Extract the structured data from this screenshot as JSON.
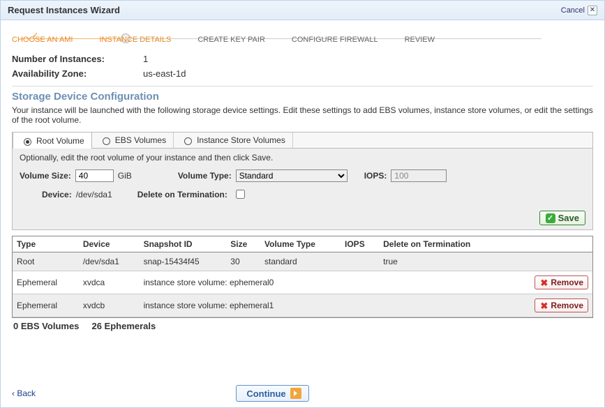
{
  "window": {
    "title": "Request Instances Wizard",
    "cancel": "Cancel"
  },
  "steps": {
    "s1": "CHOOSE AN AMI",
    "s2": "INSTANCE DETAILS",
    "s3": "CREATE KEY PAIR",
    "s4": "CONFIGURE FIREWALL",
    "s5": "REVIEW"
  },
  "kv": {
    "num_label": "Number of Instances:",
    "num_val": "1",
    "az_label": "Availability Zone:",
    "az_val": "us-east-1d"
  },
  "section": {
    "title": "Storage Device Configuration",
    "desc": "Your instance will be launched with the following storage device settings. Edit these settings to add EBS volumes, instance store volumes, or edit the settings of the root volume."
  },
  "tabs": {
    "root": "Root Volume",
    "ebs": "EBS Volumes",
    "ins": "Instance Store Volumes"
  },
  "tabnote": "Optionally, edit the root volume of your instance and then click Save.",
  "form": {
    "volsize_label": "Volume Size:",
    "volsize_val": "40",
    "volsize_unit": "GiB",
    "voltype_label": "Volume Type:",
    "voltype_val": "Standard",
    "iops_label": "IOPS:",
    "iops_val": "100",
    "device_label": "Device:",
    "device_val": "/dev/sda1",
    "dot_label": "Delete on Termination:"
  },
  "buttons": {
    "save": "Save",
    "remove": "Remove",
    "continue": "Continue",
    "back": "Back"
  },
  "table": {
    "h_type": "Type",
    "h_device": "Device",
    "h_snap": "Snapshot ID",
    "h_size": "Size",
    "h_voltype": "Volume Type",
    "h_iops": "IOPS",
    "h_dot": "Delete on Termination",
    "rows": [
      {
        "type": "Root",
        "device": "/dev/sda1",
        "snap": "snap-15434f45",
        "size": "30",
        "voltype": "standard",
        "iops": "",
        "dot": "true",
        "removable": false
      },
      {
        "type": "Ephemeral",
        "device": "xvdca",
        "snap": "instance store volume: ephemeral0",
        "size": "",
        "voltype": "",
        "iops": "",
        "dot": "",
        "removable": true
      },
      {
        "type": "Ephemeral",
        "device": "xvdcb",
        "snap": "instance store volume: ephemeral1",
        "size": "",
        "voltype": "",
        "iops": "",
        "dot": "",
        "removable": true
      }
    ]
  },
  "summary": {
    "ebs": "0 EBS Volumes",
    "eph": "26 Ephemerals"
  }
}
